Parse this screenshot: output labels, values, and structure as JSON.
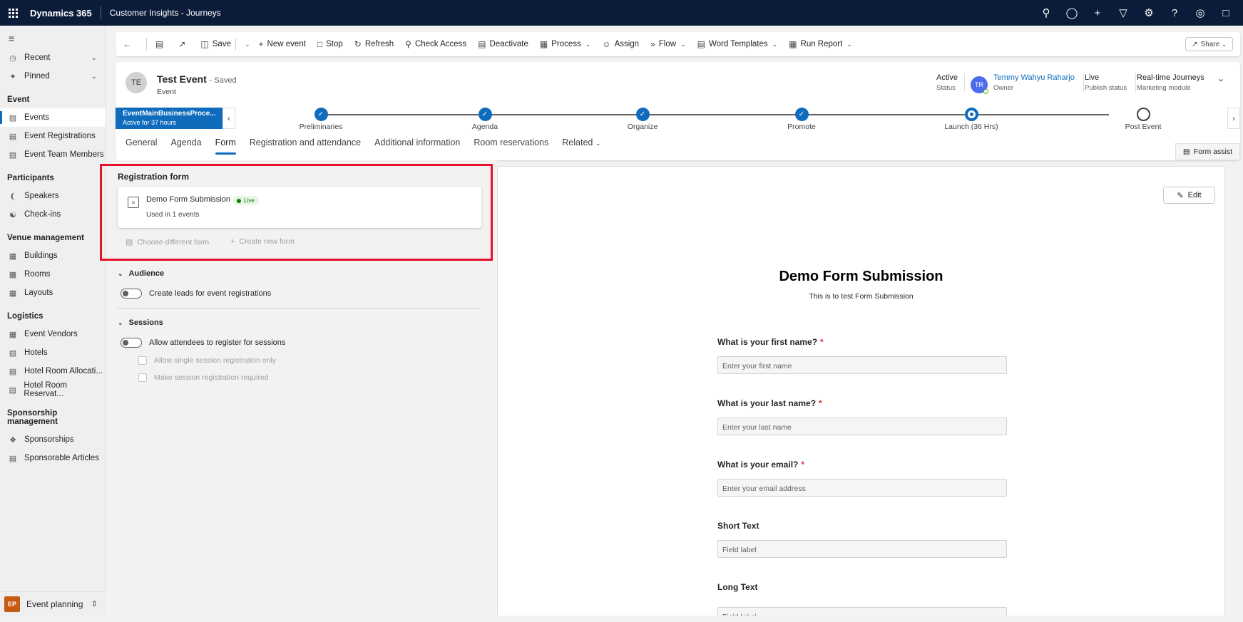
{
  "topbar": {
    "brand": "Dynamics 365",
    "app": "Customer Insights - Journeys",
    "icons": [
      "search-icon",
      "lightbulb-icon",
      "plus-icon",
      "filter-icon",
      "settings-icon",
      "help-icon",
      "copilot-icon",
      "chat-icon"
    ]
  },
  "sidebar": {
    "top_items": [
      {
        "label": "Recent",
        "icon": "clock-icon"
      },
      {
        "label": "Pinned",
        "icon": "pin-icon"
      }
    ],
    "groups": [
      {
        "title": "Event",
        "items": [
          "Events",
          "Event Registrations",
          "Event Team Members"
        ]
      },
      {
        "title": "Participants",
        "items": [
          "Speakers",
          "Check-ins"
        ]
      },
      {
        "title": "Venue management",
        "items": [
          "Buildings",
          "Rooms",
          "Layouts"
        ]
      },
      {
        "title": "Logistics",
        "items": [
          "Event Vendors",
          "Hotels",
          "Hotel Room Allocati...",
          "Hotel Room Reservat..."
        ]
      },
      {
        "title": "Sponsorship management",
        "items": [
          "Sponsorships",
          "Sponsorable Articles"
        ]
      }
    ],
    "area": {
      "badge": "EP",
      "label": "Event planning"
    }
  },
  "toolbar": {
    "save": "Save",
    "new_event": "New event",
    "stop": "Stop",
    "refresh": "Refresh",
    "check_access": "Check Access",
    "deactivate": "Deactivate",
    "process": "Process",
    "assign": "Assign",
    "flow": "Flow",
    "word_templates": "Word Templates",
    "run_report": "Run Report",
    "share": "Share"
  },
  "record": {
    "initials": "TE",
    "title": "Test Event",
    "saved": "- Saved",
    "type": "Event",
    "status_value": "Active",
    "status_label": "Status",
    "owner_initials": "TR",
    "owner_name": "Temmy Wahyu Raharjo",
    "owner_label": "Owner",
    "publish_value": "Live",
    "publish_label": "Publish status",
    "module_value": "Real-time Journeys",
    "module_label": "Marketing module"
  },
  "bpf": {
    "name": "EventMainBusinessProce...",
    "active_for": "Active for 37 hours",
    "stages": [
      {
        "name": "Preliminaries",
        "state": "done"
      },
      {
        "name": "Agenda",
        "state": "done"
      },
      {
        "name": "Organize",
        "state": "done"
      },
      {
        "name": "Promote",
        "state": "done"
      },
      {
        "name": "Launch  (36 Hrs)",
        "state": "active"
      },
      {
        "name": "Post Event",
        "state": "future"
      }
    ]
  },
  "tabs": [
    "General",
    "Agenda",
    "Form",
    "Registration and attendance",
    "Additional information",
    "Room reservations",
    "Related"
  ],
  "selected_tab": "Form",
  "form_assist": "Form assist",
  "registration": {
    "section_title": "Registration form",
    "form_name": "Demo Form Submission",
    "live_badge": "Live",
    "used_in": "Used in 1 events",
    "choose_different": "Choose different form",
    "create_new": "Create new form"
  },
  "audience": {
    "title": "Audience",
    "toggle_label": "Create leads for event registrations"
  },
  "sessions": {
    "title": "Sessions",
    "toggle_label": "Allow attendees to register for sessions",
    "option1": "Allow single session registration only",
    "option2": "Make session registration required"
  },
  "preview": {
    "edit": "Edit",
    "title": "Demo Form Submission",
    "subtitle": "This is to test Form Submission",
    "fields": [
      {
        "label": "What is your first name?",
        "required": true,
        "placeholder": "Enter your first name"
      },
      {
        "label": "What is your last name?",
        "required": true,
        "placeholder": "Enter your last name"
      },
      {
        "label": "What is your email?",
        "required": true,
        "placeholder": "Enter your email address"
      },
      {
        "label": "Short Text",
        "required": false,
        "placeholder": "Field label"
      },
      {
        "label": "Long Text",
        "required": false,
        "placeholder": "Field label"
      }
    ]
  },
  "colors": {
    "accent": "#0f6cbd",
    "topbar": "#0b1c3a",
    "highlight": "#e8112d",
    "live": "#107c10"
  }
}
